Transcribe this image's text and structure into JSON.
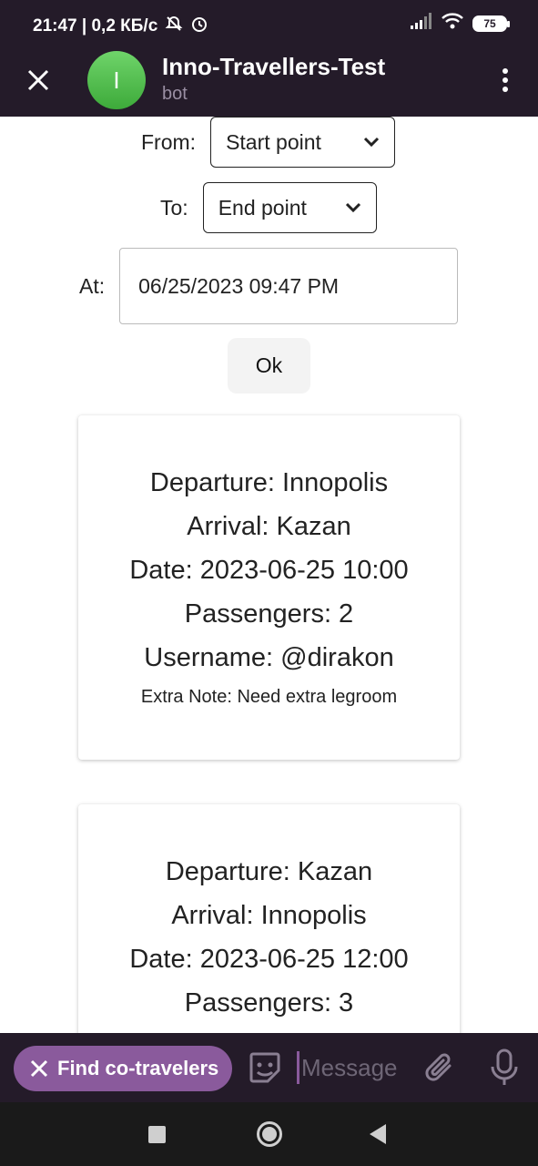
{
  "status_bar": {
    "time_and_speed": "21:47 | 0,2 КБ/с",
    "battery": "75"
  },
  "header": {
    "title": "Inno-Travellers-Test",
    "subtitle": "bot",
    "avatar_letter": "I",
    "avatar_color": "#4caf50"
  },
  "form": {
    "from_label": "From:",
    "from_value": "Start point",
    "to_label": "To:",
    "to_value": "End point",
    "at_label": "At:",
    "at_value": "06/25/2023 09:47 PM",
    "ok_label": "Ok"
  },
  "trips": [
    {
      "departure": "Departure: Innopolis",
      "arrival": "Arrival: Kazan",
      "date": "Date: 2023-06-25 10:00",
      "passengers": "Passengers: 2",
      "username": "Username: @dirakon",
      "note": "Extra Note: Need extra legroom"
    },
    {
      "departure": "Departure: Kazan",
      "arrival": "Arrival: Innopolis",
      "date": "Date: 2023-06-25 12:00",
      "passengers": "Passengers: 3"
    }
  ],
  "input_bar": {
    "bot_button_label": "Find co-travelers",
    "message_placeholder": "Message",
    "accent_color": "#8a5a9c"
  },
  "icons": [
    "close-icon",
    "more-vertical-icon",
    "sticker-icon",
    "attach-icon",
    "mic-icon",
    "wifi-icon",
    "signal-icon",
    "alarm-icon",
    "bell-off-icon"
  ]
}
